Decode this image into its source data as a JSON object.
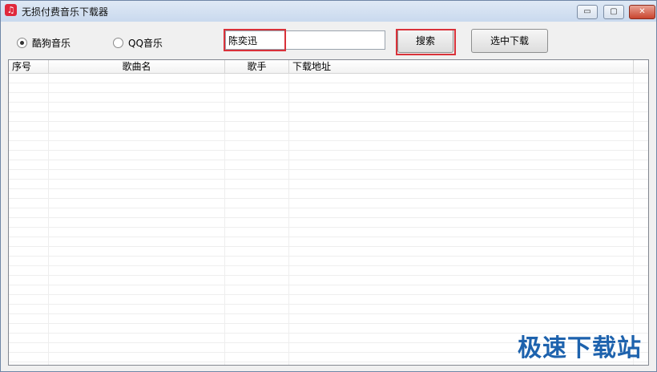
{
  "window": {
    "title": "无损付费音乐下载器"
  },
  "controls": {
    "minimize": "▭",
    "maximize": "▢",
    "close": "✕"
  },
  "sources": [
    {
      "label": "酷狗音乐",
      "selected": true
    },
    {
      "label": "QQ音乐",
      "selected": false
    }
  ],
  "search": {
    "value": "陈奕迅",
    "button_label": "搜索"
  },
  "download_button_label": "选中下载",
  "table": {
    "columns": [
      "序号",
      "歌曲名",
      "歌手",
      "下载地址"
    ],
    "rows": []
  },
  "watermark": "极速下载站",
  "colors": {
    "highlight": "#d9323a",
    "watermark": "#1d62ad"
  }
}
